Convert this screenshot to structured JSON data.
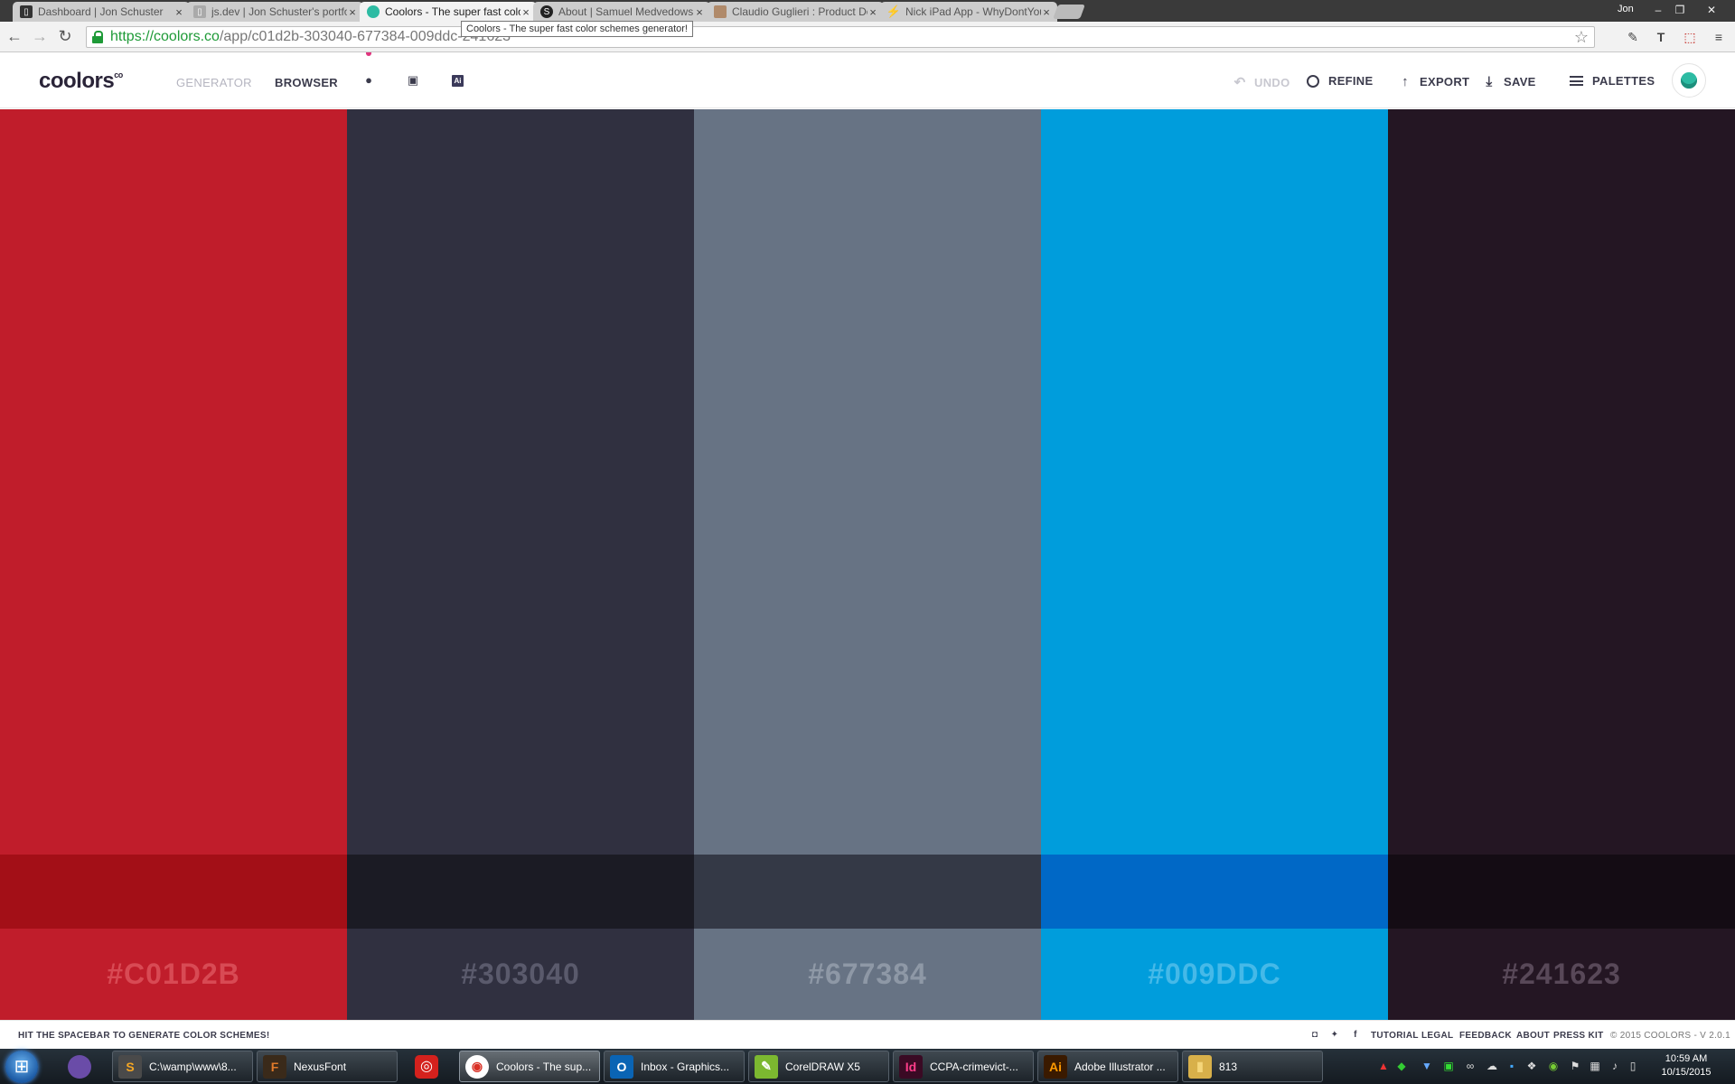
{
  "browser": {
    "tabs": [
      {
        "title": "Dashboard | Jon Schuster",
        "icon": "page-icon",
        "color": "#333333"
      },
      {
        "title": "js.dev | Jon Schuster's portfolio",
        "icon": "page-icon",
        "color": "#999999"
      },
      {
        "title": "Coolors - The super fast color schemes generator!",
        "icon": "coolors-icon",
        "color": "#2dbba3",
        "active": true
      },
      {
        "title": "About | Samuel Medvedowsky",
        "icon": "s-icon",
        "color": "#222222"
      },
      {
        "title": "Claudio Guglieri : Product Designer",
        "icon": "avatar-icon",
        "color": "#b08a6a"
      },
      {
        "title": "Nick iPad App - WhyDontYou",
        "icon": "bolt-icon",
        "color": "#222222"
      }
    ],
    "tab_close": "×",
    "tooltip": "Coolors - The super fast color schemes generator!",
    "url": {
      "scheme": "https://coolors.co",
      "path": "/app/c01d2b-303040-677384-009ddc-241623"
    },
    "user": "Jon",
    "window_buttons": [
      "–",
      "❐",
      "✕"
    ]
  },
  "app": {
    "logo": "coolors",
    "logo_mark": "co",
    "nav": {
      "generator": "GENERATOR",
      "browser": "BROWSER",
      "ai_badge": "Ai"
    },
    "actions": {
      "undo": "UNDO",
      "refine": "REFINE",
      "export": "EXPORT",
      "save": "SAVE",
      "palettes": "PALETTES"
    }
  },
  "palette": [
    {
      "hex": "#C01D2B",
      "color": "#c01d2b",
      "shade": "#a30f17",
      "label_color": "#d84a54"
    },
    {
      "hex": "#303040",
      "color": "#303040",
      "shade": "#1b1b24",
      "label_color": "#5a5a6c"
    },
    {
      "hex": "#677384",
      "color": "#677384",
      "shade": "#343946",
      "label_color": "#8e98a6"
    },
    {
      "hex": "#009DDC",
      "color": "#009ddc",
      "shade": "#0068c6",
      "label_color": "#45b9e8"
    },
    {
      "hex": "#241623",
      "color": "#241623",
      "shade": "#140c14",
      "label_color": "#584858"
    }
  ],
  "footer": {
    "hint": "HIT THE SPACEBAR TO GENERATE COLOR SCHEMES!",
    "links": {
      "tutorial": "TUTORIAL",
      "legal": "LEGAL",
      "feedback": "FEEDBACK",
      "about": "ABOUT",
      "press_kit": "PRESS KIT"
    },
    "copyright": "© 2015 COOLORS - V 2.0.1"
  },
  "taskbar": {
    "items": [
      {
        "title": "C:\\wamp\\www\\8...",
        "icon_letter": "S",
        "icon_bg": "#4a4a4a",
        "icon_fg": "#f5a623"
      },
      {
        "title": "NexusFont",
        "icon_letter": "F",
        "icon_bg": "#3a2a1a",
        "icon_fg": "#e07a2a"
      },
      {
        "title": "Coolors - The sup...",
        "icon_letter": "◉",
        "icon_bg": "#ffffff",
        "icon_fg": "#d93025",
        "active": true
      },
      {
        "title": "Inbox - Graphics...",
        "icon_letter": "O",
        "icon_bg": "#0a64b4",
        "icon_fg": "#ffffff"
      },
      {
        "title": "CorelDRAW X5",
        "icon_letter": "✎",
        "icon_bg": "#7cb830",
        "icon_fg": "#ffffff"
      },
      {
        "title": "CCPA-crimevict-...",
        "icon_letter": "Id",
        "icon_bg": "#3a0a24",
        "icon_fg": "#ff3d8a"
      },
      {
        "title": "Adobe Illustrator ...",
        "icon_letter": "Ai",
        "icon_bg": "#3a1a00",
        "icon_fg": "#ff9a00"
      },
      {
        "title": "813",
        "icon_letter": "▮",
        "icon_bg": "#d8b04a",
        "icon_fg": "#f5d67a"
      }
    ],
    "clock": {
      "time": "10:59 AM",
      "date": "10/15/2015"
    }
  }
}
